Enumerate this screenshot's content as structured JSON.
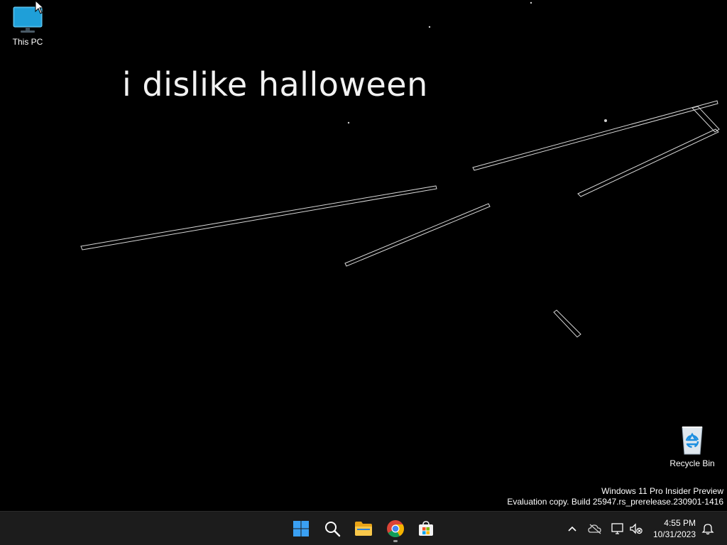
{
  "desktop": {
    "wallpaper_text": "i dislike halloween",
    "background_color": "#000000",
    "icons": [
      {
        "label": "This PC",
        "icon": "monitor-icon"
      },
      {
        "label": "Recycle Bin",
        "icon": "recycle-bin-icon"
      }
    ],
    "watermark": {
      "line1": "Windows 11 Pro Insider Preview",
      "line2": "Evaluation copy. Build 25947.rs_prerelease.230901-1416"
    }
  },
  "taskbar": {
    "background": "#1c1c1c",
    "pinned": [
      {
        "name": "Start",
        "icon": "windows-start-icon"
      },
      {
        "name": "Search",
        "icon": "search-icon"
      },
      {
        "name": "File Explorer",
        "icon": "folder-icon"
      },
      {
        "name": "Google Chrome",
        "icon": "chrome-icon",
        "running": true
      },
      {
        "name": "Microsoft Store",
        "icon": "store-icon"
      }
    ],
    "tray": {
      "icons": [
        "chevron-up-icon",
        "onedrive-offline-icon",
        "network-icon",
        "volume-muted-icon",
        "notification-bell-icon"
      ],
      "time": "4:55 PM",
      "date": "10/31/2023"
    }
  }
}
